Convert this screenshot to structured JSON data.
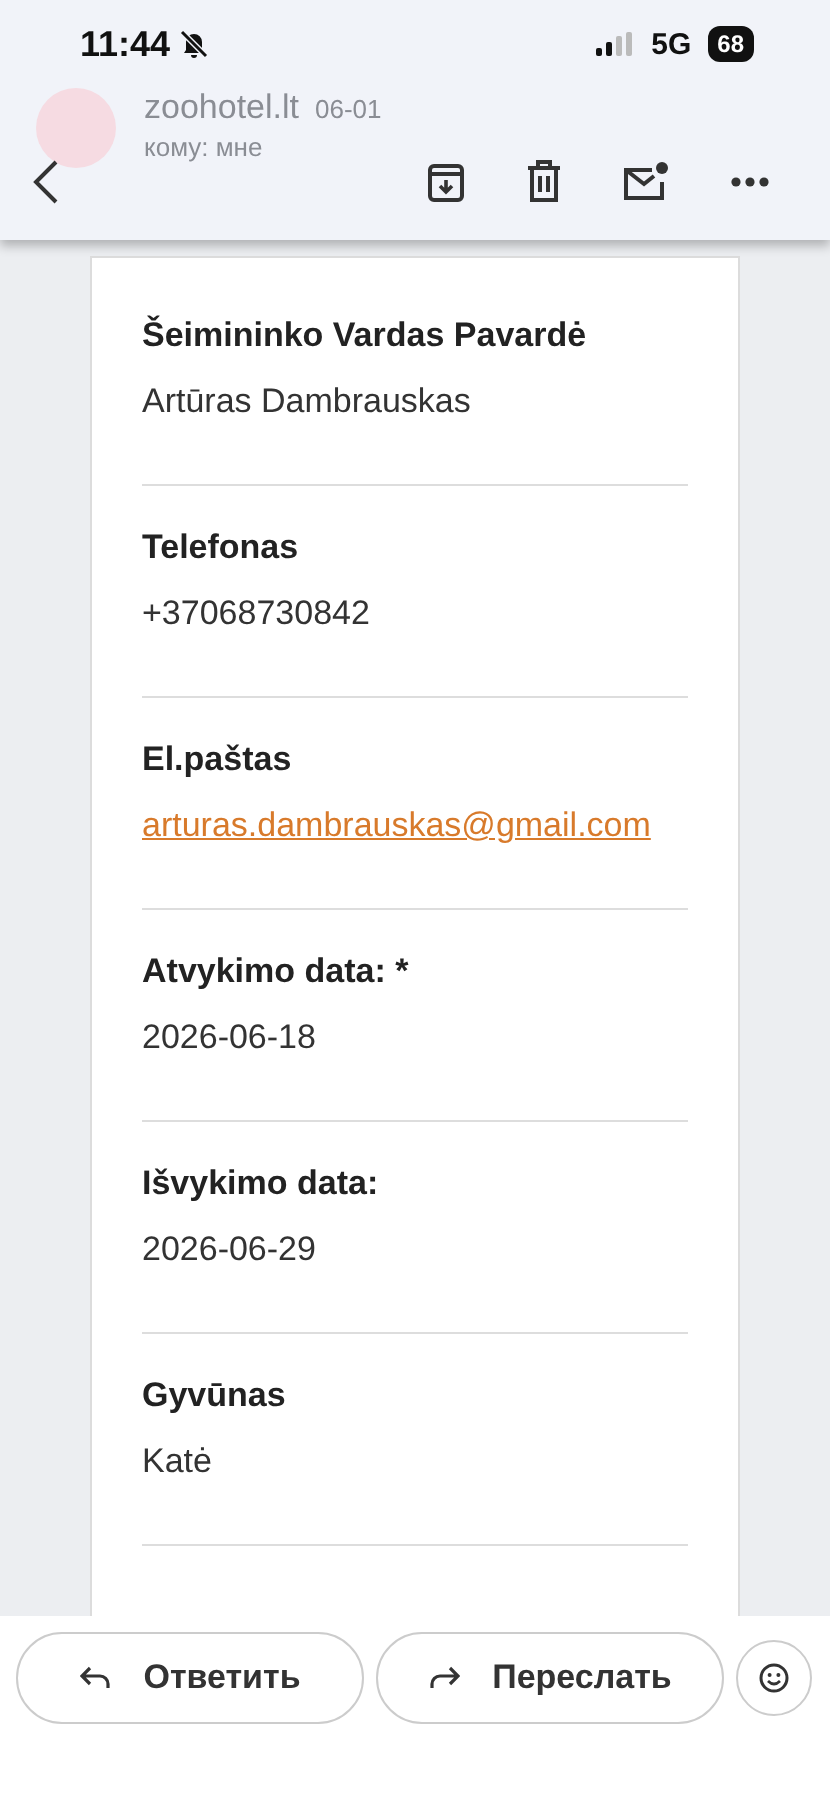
{
  "status_bar": {
    "time": "11:44",
    "network": "5G",
    "battery": "68"
  },
  "background_message": {
    "sender": "zoohotel.lt",
    "date": "06-01",
    "recipient": "кому: мне"
  },
  "fields": [
    {
      "label": "Šeimininko Vardas Pavardė",
      "value": "Artūras Dambrauskas",
      "kind": "text"
    },
    {
      "label": "Telefonas",
      "value": "+37068730842",
      "kind": "text"
    },
    {
      "label": "El.paštas",
      "value": "arturas.dambrauskas@gmail.com",
      "kind": "link"
    },
    {
      "label": "Atvykimo data: *",
      "value": "2026-06-18",
      "kind": "text"
    },
    {
      "label": "Išvykimo data:",
      "value": "2026-06-29",
      "kind": "text"
    },
    {
      "label": "Gyvūnas",
      "value": "Katė",
      "kind": "text"
    }
  ],
  "actions": [
    {
      "label": "Ответить",
      "kind": "reply"
    },
    {
      "label": "Переслать",
      "kind": "forward"
    }
  ]
}
